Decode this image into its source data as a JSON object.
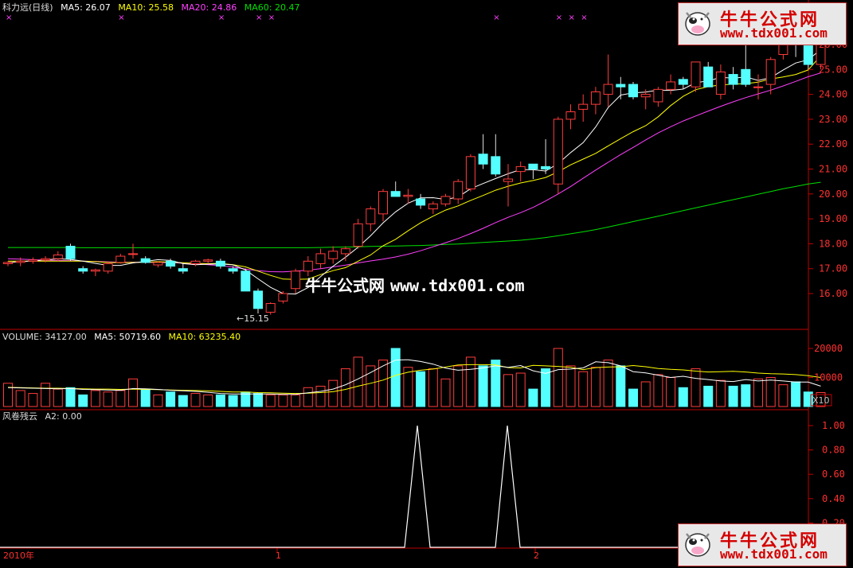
{
  "header": {
    "title": "科力远(日线)",
    "ma5": "MA5: 26.07",
    "ma10": "MA10: 25.58",
    "ma20": "MA20: 24.86",
    "ma60": "MA60: 20.47"
  },
  "volume_header": {
    "title": "VOLUME: 34127.00",
    "ma5": "MA5: 50719.60",
    "ma10": "MA10: 63235.40"
  },
  "indicator_header": {
    "title": "风卷残云",
    "a2": "A2: 0.00"
  },
  "annotations": {
    "low_label": "←15.15",
    "multiplier": "X10"
  },
  "watermark": {
    "cn": "牛牛公式网",
    "url": "www.tdx001.com",
    "center": "牛牛公式网",
    "center_url": "www.tdx001.com"
  },
  "xaxis": {
    "year": "2010年",
    "m1": "1",
    "m2": "2"
  },
  "colors": {
    "up": "#ff3c3c",
    "down": "#54ffff",
    "ma5": "#ffffff",
    "ma10": "#ffff00",
    "ma20": "#ff40ff",
    "ma60": "#00e000",
    "axis": "#c00000"
  },
  "chart_data": [
    {
      "type": "candlestick",
      "yticks": [
        "16.00",
        "17.00",
        "18.00",
        "19.00",
        "20.00",
        "21.00",
        "22.00",
        "23.00",
        "24.00",
        "25.00",
        "26.00"
      ],
      "ylim": [
        15.0,
        26.5
      ],
      "ohlc": [
        [
          17.2,
          17.3,
          17.1,
          17.25
        ],
        [
          17.25,
          17.45,
          17.1,
          17.3
        ],
        [
          17.3,
          17.45,
          17.2,
          17.35
        ],
        [
          17.35,
          17.5,
          17.25,
          17.4
        ],
        [
          17.4,
          17.7,
          17.3,
          17.55
        ],
        [
          17.9,
          18.0,
          17.3,
          17.4
        ],
        [
          17.0,
          17.1,
          16.8,
          16.9
        ],
        [
          16.9,
          17.0,
          16.7,
          16.95
        ],
        [
          16.9,
          17.3,
          16.8,
          17.2
        ],
        [
          17.25,
          17.6,
          17.2,
          17.5
        ],
        [
          17.6,
          18.0,
          17.4,
          17.6
        ],
        [
          17.4,
          17.5,
          17.2,
          17.25
        ],
        [
          17.15,
          17.3,
          17.05,
          17.25
        ],
        [
          17.3,
          17.4,
          17.0,
          17.1
        ],
        [
          17.0,
          17.2,
          16.8,
          16.9
        ],
        [
          17.2,
          17.35,
          17.1,
          17.3
        ],
        [
          17.3,
          17.4,
          17.2,
          17.35
        ],
        [
          17.3,
          17.4,
          17.0,
          17.1
        ],
        [
          17.0,
          17.1,
          16.8,
          16.9
        ],
        [
          16.9,
          17.0,
          16.1,
          16.1
        ],
        [
          16.1,
          16.2,
          15.2,
          15.4
        ],
        [
          15.25,
          15.65,
          15.15,
          15.6
        ],
        [
          15.7,
          16.1,
          15.6,
          16.0
        ],
        [
          16.2,
          17.0,
          16.0,
          16.9
        ],
        [
          16.9,
          17.5,
          16.7,
          17.3
        ],
        [
          17.2,
          17.8,
          17.0,
          17.6
        ],
        [
          17.4,
          17.9,
          17.2,
          17.7
        ],
        [
          17.6,
          17.9,
          17.3,
          17.8
        ],
        [
          17.9,
          19.0,
          17.8,
          18.8
        ],
        [
          18.8,
          19.5,
          18.5,
          19.4
        ],
        [
          19.2,
          20.2,
          18.9,
          20.1
        ],
        [
          20.1,
          20.5,
          19.9,
          19.9
        ],
        [
          19.9,
          20.2,
          19.6,
          19.95
        ],
        [
          19.8,
          20.0,
          19.4,
          19.55
        ],
        [
          19.4,
          19.7,
          19.2,
          19.6
        ],
        [
          19.6,
          20.0,
          19.5,
          19.9
        ],
        [
          19.8,
          20.6,
          19.6,
          20.5
        ],
        [
          20.2,
          21.6,
          20.1,
          21.5
        ],
        [
          21.6,
          22.4,
          21.0,
          21.2
        ],
        [
          21.5,
          22.4,
          20.7,
          20.8
        ],
        [
          20.5,
          21.2,
          19.5,
          20.6
        ],
        [
          20.9,
          21.3,
          20.5,
          21.1
        ],
        [
          21.2,
          21.2,
          20.6,
          21.0
        ],
        [
          21.1,
          22.2,
          20.8,
          21.0
        ],
        [
          20.4,
          23.1,
          20.0,
          23.0
        ],
        [
          23.0,
          23.6,
          22.6,
          23.3
        ],
        [
          23.4,
          24.0,
          22.9,
          23.6
        ],
        [
          23.6,
          24.3,
          23.2,
          24.1
        ],
        [
          24.0,
          25.6,
          23.5,
          24.4
        ],
        [
          24.4,
          24.7,
          23.8,
          24.3
        ],
        [
          24.4,
          24.5,
          23.8,
          23.9
        ],
        [
          23.9,
          24.2,
          23.4,
          24.0
        ],
        [
          23.7,
          24.3,
          23.5,
          24.2
        ],
        [
          24.2,
          24.8,
          24.0,
          24.5
        ],
        [
          24.6,
          24.7,
          24.2,
          24.4
        ],
        [
          24.3,
          25.3,
          24.1,
          25.3
        ],
        [
          25.1,
          25.3,
          24.3,
          24.3
        ],
        [
          24.0,
          25.2,
          23.8,
          24.9
        ],
        [
          24.8,
          25.1,
          24.2,
          24.4
        ],
        [
          25.0,
          26.0,
          24.3,
          24.4
        ],
        [
          24.3,
          24.8,
          23.8,
          24.3
        ],
        [
          24.4,
          25.5,
          24.0,
          25.4
        ],
        [
          25.6,
          26.5,
          25.4,
          26.4
        ],
        [
          26.3,
          26.9,
          25.5,
          26.0
        ],
        [
          26.0,
          26.6,
          25.0,
          25.2
        ],
        [
          25.2,
          26.2,
          25.0,
          26.0
        ]
      ],
      "ma5": [
        17.25,
        17.28,
        17.31,
        17.35,
        17.4,
        17.37,
        17.3,
        17.21,
        17.13,
        17.13,
        17.23,
        17.29,
        17.36,
        17.33,
        17.2,
        17.16,
        17.18,
        17.19,
        17.15,
        16.95,
        16.59,
        16.25,
        16.0,
        15.98,
        16.24,
        16.68,
        17.1,
        17.46,
        17.86,
        18.32,
        18.84,
        19.28,
        19.63,
        19.84,
        19.85,
        19.78,
        19.88,
        20.21,
        20.42,
        20.62,
        20.81,
        20.98,
        20.97,
        20.92,
        21.22,
        21.66,
        22.06,
        22.69,
        23.47,
        23.97,
        24.06,
        24.09,
        24.17,
        24.16,
        24.21,
        24.47,
        24.54,
        24.68,
        24.65,
        24.7,
        24.56,
        24.67,
        24.98,
        25.26,
        25.39,
        25.8
      ],
      "ma10": [
        17.3,
        17.3,
        17.3,
        17.3,
        17.3,
        17.3,
        17.3,
        17.28,
        17.25,
        17.24,
        17.25,
        17.26,
        17.28,
        17.26,
        17.24,
        17.21,
        17.2,
        17.21,
        17.16,
        17.07,
        16.9,
        16.73,
        16.58,
        16.57,
        16.58,
        16.76,
        16.92,
        17.04,
        17.3,
        17.55,
        17.92,
        18.18,
        18.52,
        18.84,
        19.11,
        19.35,
        19.52,
        19.74,
        19.94,
        20.15,
        20.31,
        20.44,
        20.54,
        20.66,
        20.89,
        21.17,
        21.4,
        21.63,
        21.93,
        22.22,
        22.5,
        22.74,
        23.1,
        23.55,
        23.92,
        24.19,
        24.31,
        24.38,
        24.41,
        24.43,
        24.49,
        24.62,
        24.7,
        24.8,
        24.98,
        25.55
      ],
      "ma20": [
        17.4,
        17.38,
        17.36,
        17.34,
        17.33,
        17.32,
        17.3,
        17.29,
        17.27,
        17.26,
        17.26,
        17.25,
        17.25,
        17.24,
        17.22,
        17.2,
        17.16,
        17.12,
        17.06,
        16.98,
        16.92,
        16.88,
        16.87,
        16.9,
        16.94,
        17.0,
        17.07,
        17.14,
        17.23,
        17.31,
        17.38,
        17.47,
        17.58,
        17.72,
        17.88,
        18.04,
        18.21,
        18.41,
        18.62,
        18.85,
        19.06,
        19.25,
        19.46,
        19.72,
        20.0,
        20.3,
        20.63,
        20.96,
        21.27,
        21.58,
        21.87,
        22.17,
        22.45,
        22.7,
        22.93,
        23.13,
        23.33,
        23.52,
        23.7,
        23.87,
        24.02,
        24.17,
        24.34,
        24.52,
        24.71,
        24.86
      ],
      "ma60": [
        17.85,
        17.85,
        17.85,
        17.85,
        17.85,
        17.85,
        17.84,
        17.84,
        17.84,
        17.84,
        17.84,
        17.84,
        17.84,
        17.84,
        17.84,
        17.84,
        17.84,
        17.84,
        17.84,
        17.84,
        17.84,
        17.84,
        17.84,
        17.84,
        17.84,
        17.85,
        17.86,
        17.87,
        17.88,
        17.89,
        17.9,
        17.91,
        17.92,
        17.93,
        17.95,
        17.97,
        17.99,
        18.02,
        18.05,
        18.08,
        18.11,
        18.14,
        18.19,
        18.25,
        18.32,
        18.4,
        18.48,
        18.57,
        18.67,
        18.78,
        18.89,
        19.0,
        19.11,
        19.22,
        19.33,
        19.44,
        19.55,
        19.66,
        19.77,
        19.88,
        19.99,
        20.1,
        20.21,
        20.3,
        20.4,
        20.47
      ]
    },
    {
      "type": "bar",
      "yticks": [
        "10000",
        "20000"
      ],
      "ylim": [
        0,
        24000
      ],
      "volume": [
        8000,
        5500,
        4500,
        8000,
        6000,
        6500,
        4000,
        5500,
        5000,
        5500,
        9500,
        6000,
        4000,
        5000,
        3800,
        4500,
        4000,
        4000,
        3800,
        5000,
        4500,
        4000,
        4000,
        4000,
        6500,
        7000,
        9000,
        13000,
        17000,
        14000,
        16000,
        20000,
        13500,
        12000,
        13000,
        9500,
        14000,
        17000,
        14000,
        16000,
        11000,
        11500,
        6000,
        13000,
        20000,
        14000,
        12000,
        13500,
        16000,
        14000,
        6000,
        8500,
        11000,
        10000,
        6500,
        13000,
        7000,
        9000,
        7000,
        7500,
        9500,
        10000,
        7500,
        8500,
        5000,
        4800
      ],
      "ma5": [
        6500,
        6400,
        6300,
        6200,
        6100,
        6200,
        5900,
        5800,
        5700,
        5600,
        6200,
        6100,
        5900,
        5600,
        5400,
        5200,
        4900,
        4500,
        4300,
        4300,
        4300,
        4300,
        4200,
        4200,
        4700,
        5200,
        6000,
        7500,
        9500,
        11700,
        14000,
        16000,
        16100,
        15500,
        14600,
        13200,
        12500,
        12800,
        13300,
        14000,
        13500,
        14100,
        12300,
        11400,
        12700,
        12900,
        13300,
        15400,
        15100,
        14000,
        12000,
        11600,
        10800,
        10000,
        10400,
        9700,
        9300,
        8800,
        8600,
        9300,
        8800,
        9100,
        8800,
        8400,
        8400,
        7000
      ],
      "ma10": [
        6600,
        6500,
        6400,
        6300,
        6300,
        6200,
        6100,
        6000,
        6000,
        5900,
        6000,
        5900,
        5800,
        5700,
        5600,
        5500,
        5400,
        5200,
        5000,
        5000,
        4800,
        4700,
        4600,
        4500,
        4600,
        4800,
        5100,
        5900,
        7000,
        8000,
        9100,
        10700,
        11800,
        12500,
        12900,
        13600,
        14300,
        14400,
        14400,
        14300,
        13400,
        13300,
        14200,
        14000,
        13800,
        13500,
        12700,
        13400,
        13600,
        13700,
        14100,
        13700,
        13100,
        12800,
        12600,
        12200,
        11900,
        12000,
        12100,
        11900,
        11500,
        11300,
        11200,
        11000,
        10600,
        10000
      ]
    },
    {
      "type": "line",
      "name": "A2",
      "yticks": [
        "0.20",
        "0.40",
        "0.60",
        "0.80",
        "1.00"
      ],
      "ylim": [
        -0.05,
        1.1
      ],
      "x": [
        0,
        508,
        524,
        540,
        622,
        637,
        653,
        1015
      ],
      "y": [
        0,
        0,
        1,
        0,
        0,
        1,
        0,
        0
      ]
    }
  ]
}
